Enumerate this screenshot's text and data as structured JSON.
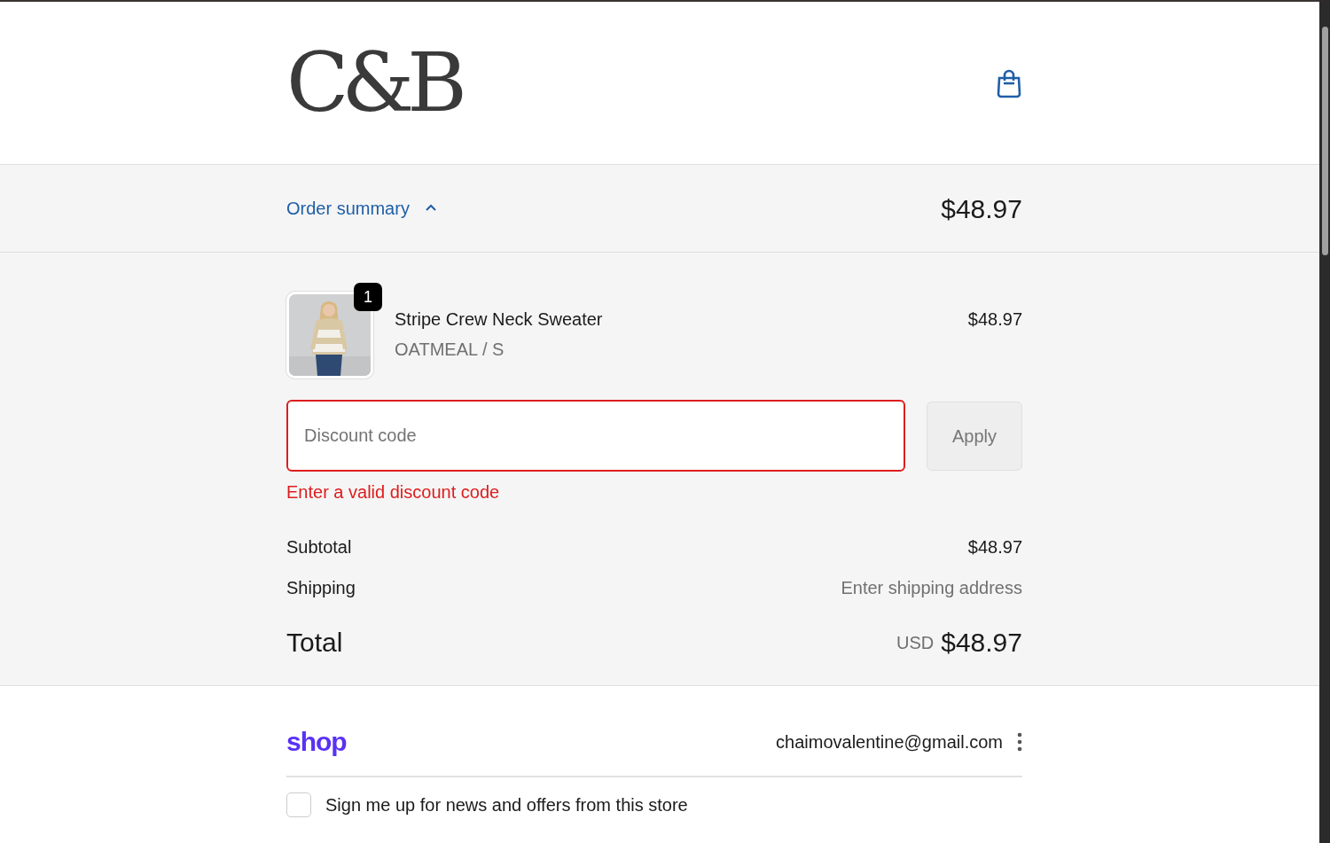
{
  "header": {
    "logo": "C&B"
  },
  "order_summary": {
    "label": "Order summary",
    "expanded": true,
    "total": "$48.97"
  },
  "line_items": [
    {
      "name": "Stripe Crew Neck Sweater",
      "variant": "OATMEAL / S",
      "quantity": "1",
      "price": "$48.97"
    }
  ],
  "discount": {
    "placeholder": "Discount code",
    "invalid": true,
    "error": "Enter a valid discount code",
    "button": "Apply",
    "button_disabled": true
  },
  "costs": [
    {
      "label": "Subtotal",
      "value": "$48.97",
      "kind": "amount"
    },
    {
      "label": "Shipping",
      "value": "Enter shipping address",
      "kind": "pending"
    }
  ],
  "total": {
    "label": "Total",
    "currency": "USD",
    "value": "$48.97"
  },
  "shop_account": {
    "logo": "shop",
    "email": "chaimovalentine@gmail.com"
  },
  "newsletter": {
    "label": "Sign me up for news and offers from this store",
    "checked": false
  }
}
